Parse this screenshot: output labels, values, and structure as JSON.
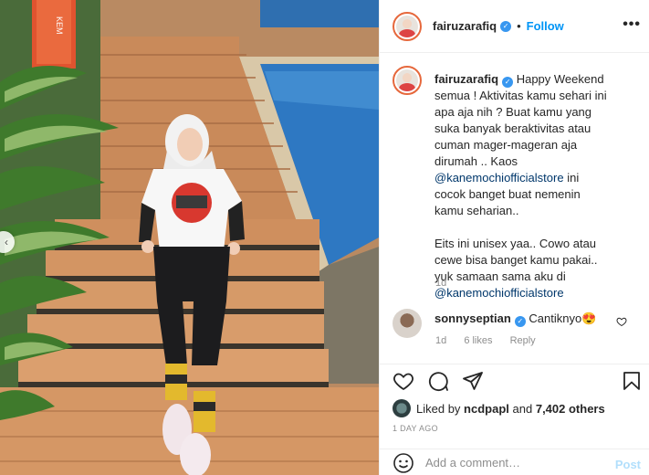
{
  "header": {
    "username": "fairuzarafiq",
    "separator": "•",
    "follow_label": "Follow",
    "more_label": "•••"
  },
  "caption": {
    "username": "fairuzarafiq",
    "text_part1": "Happy Weekend semua ! Aktivitas kamu sehari ini apa aja nih ? Buat kamu yang suka banyak beraktivitas atau cuman mager-mageran aja dirumah .. Kaos",
    "mention1": "@kanemochiofficialstore",
    "text_part2": "ini cocok banget buat nemenin kamu seharian..",
    "text_part3": "Eits ini unisex yaa.. Cowo atau cewe bisa banget kamu pakai.. yuk samaan sama aku di",
    "mention2": "@kanemochiofficialstore",
    "time": "1d"
  },
  "comment": {
    "username": "sonnyseptian",
    "text": "Cantiknyo😍",
    "time": "1d",
    "likes": "6 likes",
    "reply_label": "Reply"
  },
  "likes": {
    "prefix": "Liked by",
    "user": "ncdpapl",
    "middle": "and",
    "count": "7,402 others"
  },
  "date_label": "1 DAY AGO",
  "add_comment": {
    "placeholder": "Add a comment…",
    "post_label": "Post"
  },
  "photo": {
    "sign_text": "KEM"
  },
  "colors": {
    "accent": "#0095f6",
    "verified": "#3897f0",
    "post_disabled": "#b2dffc",
    "secondary_text": "#8e8e8e"
  }
}
